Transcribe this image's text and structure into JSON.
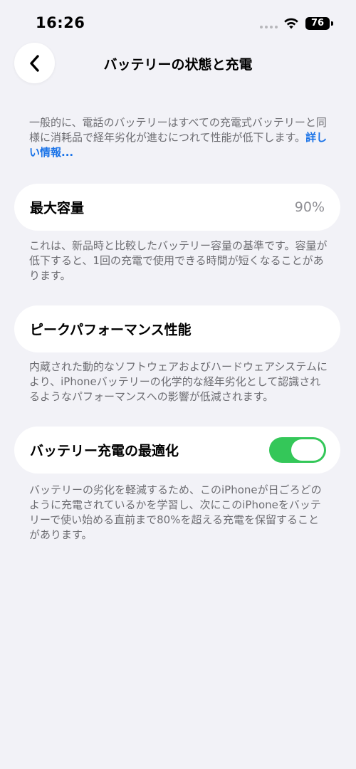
{
  "status_bar": {
    "time": "16:26",
    "battery_level": "76"
  },
  "nav": {
    "title": "バッテリーの状態と充電"
  },
  "intro": {
    "text": "一般的に、電話のバッテリーはすべての充電式バッテリーと同様に消耗品で経年劣化が進むにつれて性能が低下します。",
    "link_label": "詳しい情報..."
  },
  "max_capacity": {
    "label": "最大容量",
    "value": "90%",
    "description": "これは、新品時と比較したバッテリー容量の基準です。容量が低下すると、1回の充電で使用できる時間が短くなることがあります。"
  },
  "peak_performance": {
    "label": "ピークパフォーマンス性能",
    "description": "内蔵された動的なソフトウェアおよびハードウェアシステムにより、iPhoneバッテリーの化学的な経年劣化として認識されるようなパフォーマンスへの影響が低減されます。"
  },
  "optimized_charging": {
    "label": "バッテリー充電の最適化",
    "enabled": true,
    "description": "バッテリーの劣化を軽減するため、このiPhoneが日ごろどのように充電されているかを学習し、次にこのiPhoneをバッテリーで使い始める直前まで80%を超える充電を保留することがあります。"
  },
  "colors": {
    "background": "#f2f2f7",
    "toggle_on": "#34c759",
    "link": "#1a73e8",
    "secondary_text": "#6d6d72"
  }
}
